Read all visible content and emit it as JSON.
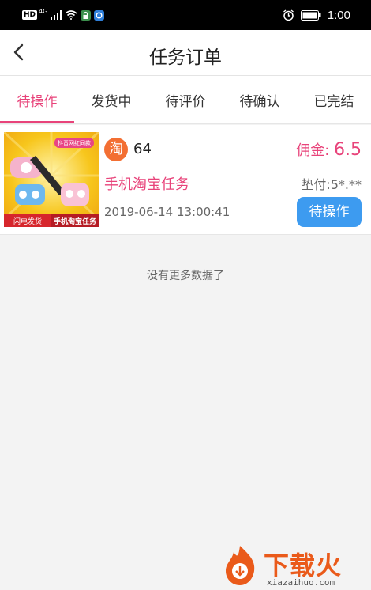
{
  "status_bar": {
    "hd_label": "HD",
    "network_label": "4G",
    "time": "1:00",
    "icons": [
      "signal-icon",
      "wifi-icon",
      "lock-app-icon",
      "app-icon",
      "alarm-icon",
      "battery-icon"
    ]
  },
  "header": {
    "title": "任务订单",
    "back_icon": "chevron-left-icon"
  },
  "tabs": [
    {
      "label": "待操作",
      "active": true
    },
    {
      "label": "发货中",
      "active": false
    },
    {
      "label": "待评价",
      "active": false
    },
    {
      "label": "待确认",
      "active": false
    },
    {
      "label": "已完结",
      "active": false
    }
  ],
  "orders": [
    {
      "platform_icon": "taobao-icon",
      "platform_glyph": "淘",
      "number": "64",
      "task_name": "手机淘宝任务",
      "datetime": "2019-06-14 13:00:41",
      "commission_label": "佣金: ",
      "commission_value": "6.5",
      "advance": "垫付:5*.**",
      "status_label": "待操作",
      "thumb": {
        "banner": "抖音网红同款",
        "badge_left": "闪电发货",
        "badge_right": "手机淘宝任务"
      }
    }
  ],
  "footer_text": "没有更多数据了",
  "watermark": {
    "text": "下载火",
    "url": "xiazaihuo.com"
  },
  "colors": {
    "accent_pink": "#e8437a",
    "button_blue": "#3d9bf0",
    "status_bar_bg": "#000000",
    "background": "#f3f3f3"
  }
}
